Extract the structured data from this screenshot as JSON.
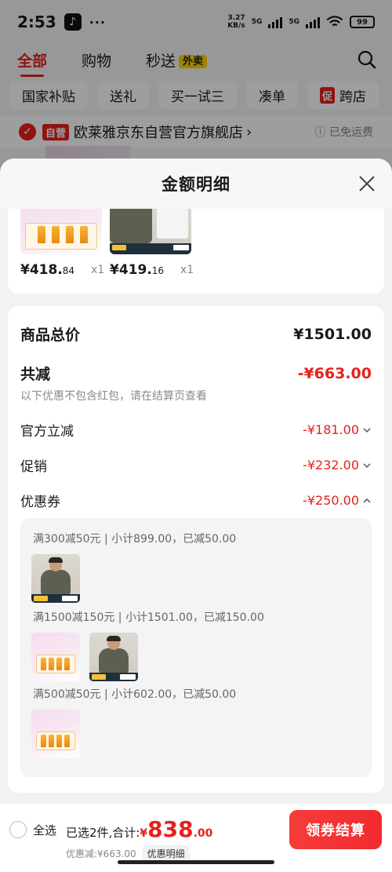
{
  "status_bar": {
    "time": "2:53",
    "dots": "···",
    "net_speed_top": "3.27",
    "net_speed_bottom": "KB/s",
    "battery": "99",
    "signal_label_1": "5G",
    "signal_label_2": "5G"
  },
  "top_tabs": {
    "all": "全部",
    "shopping": "购物",
    "instant": "秒送",
    "waimai": "外卖"
  },
  "chips": [
    "国家补贴",
    "送礼",
    "买一试三",
    "凑单",
    "跨店"
  ],
  "chip_promo_tag": "促",
  "store": {
    "tag": "自营",
    "name": "欧莱雅京东自营官方旗舰店",
    "arrow": "›",
    "shipping": "ⓘ 已免运费"
  },
  "sheet": {
    "title": "金额明细",
    "products": [
      {
        "price_main": "¥418.",
        "price_dec": "84",
        "qty": "x1"
      },
      {
        "price_main": "¥419.",
        "price_dec": "16",
        "qty": "x1"
      }
    ],
    "summary": {
      "total_label": "商品总价",
      "total_value": "¥1501.00",
      "reduce_label": "共减",
      "reduce_value": "-¥663.00",
      "note": "以下优惠不包含红包，请在结算页查看",
      "official_label": "官方立减",
      "official_value": "-¥181.00",
      "promo_label": "促销",
      "promo_value": "-¥232.00",
      "coupon_label": "优惠券",
      "coupon_value": "-¥250.00"
    },
    "coupons": [
      {
        "text": "满300减50元 | 小计899.00，已减50.00"
      },
      {
        "text": "满1500减150元 | 小计1501.00，已减150.00"
      },
      {
        "text": "满500减50元 | 小计602.00，已减50.00"
      }
    ]
  },
  "checkout": {
    "select_all": "全选",
    "selected_label": "已选2件,合计:",
    "currency": "¥",
    "total_int": "838",
    "total_dec": ".00",
    "discount_text": "优惠减:¥663.00",
    "detail_button": "优惠明细",
    "checkout_button": "领券结算"
  },
  "colors": {
    "accent_red": "#e6211c",
    "gray_text": "#888888"
  },
  "icons": [
    "tiktok-icon",
    "wifi-icon",
    "battery-icon",
    "search-icon",
    "check-icon",
    "close-icon",
    "chevron-down-icon",
    "chevron-up-icon"
  ]
}
